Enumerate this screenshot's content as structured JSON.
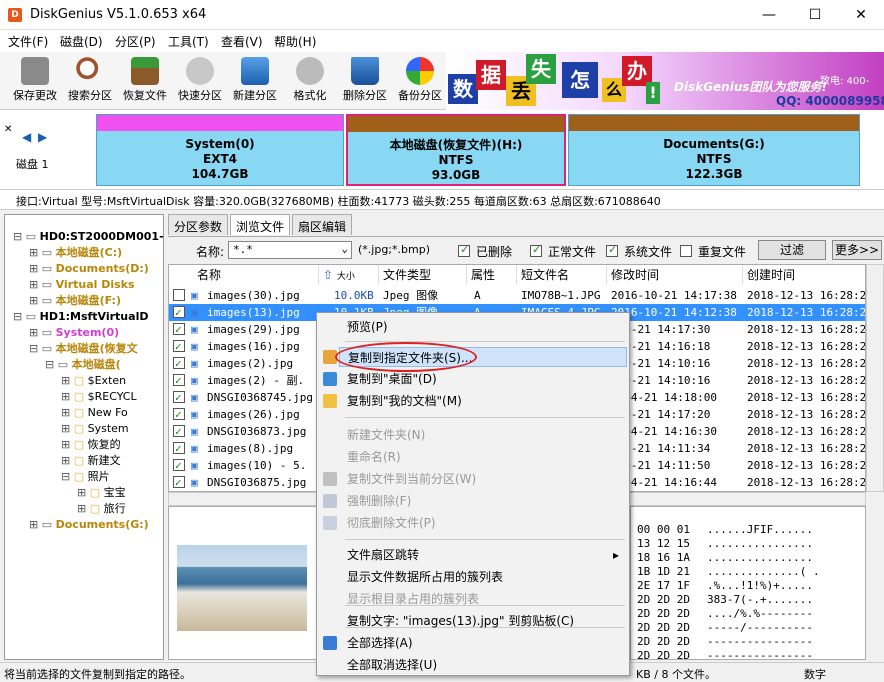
{
  "window": {
    "title": "DiskGenius V5.1.0.653 x64"
  },
  "menu": [
    "文件(F)",
    "磁盘(D)",
    "分区(P)",
    "工具(T)",
    "查看(V)",
    "帮助(H)"
  ],
  "toolbar": [
    {
      "label": "保存更改",
      "icon": "save-icon"
    },
    {
      "label": "搜索分区",
      "icon": "search-icon"
    },
    {
      "label": "恢复文件",
      "icon": "recover-icon"
    },
    {
      "label": "快速分区",
      "icon": "quick-partition-icon"
    },
    {
      "label": "新建分区",
      "icon": "new-partition-icon"
    },
    {
      "label": "格式化",
      "icon": "format-icon"
    },
    {
      "label": "删除分区",
      "icon": "delete-icon"
    },
    {
      "label": "备份分区",
      "icon": "backup-icon"
    }
  ],
  "banner": {
    "chars": [
      "数",
      "据",
      "丢",
      "失",
      "怎",
      "么",
      "办",
      "!"
    ],
    "slogan": "DiskGenius团队为您服务!",
    "phone_label": "QQ: 4000089958",
    "tel": "致电: 400-"
  },
  "disk": {
    "label": "磁盘 1",
    "partitions": [
      {
        "name": "System(0)",
        "fs": "EXT4",
        "size": "104.7GB"
      },
      {
        "name": "本地磁盘(恢复文件)(H:)",
        "fs": "NTFS",
        "size": "93.0GB"
      },
      {
        "name": "Documents(G:)",
        "fs": "NTFS",
        "size": "122.3GB"
      }
    ],
    "info": "接口:Virtual  型号:MsftVirtualDisk  容量:320.0GB(327680MB)  柱面数:41773  磁头数:255  每道扇区数:63  总扇区数:671088640"
  },
  "tree": [
    {
      "text": "HD0:ST2000DM001-",
      "bold": true,
      "color": "#000"
    },
    {
      "text": "本地磁盘(C:)",
      "bold": true,
      "color": "#b8860b"
    },
    {
      "text": "Documents(D:)",
      "bold": true,
      "color": "#b8860b"
    },
    {
      "text": "Virtual Disks",
      "bold": true,
      "color": "#b8860b"
    },
    {
      "text": "本地磁盘(F:)",
      "bold": true,
      "color": "#b8860b"
    },
    {
      "text": "HD1:MsftVirtualD",
      "bold": true,
      "color": "#000"
    },
    {
      "text": "System(0)",
      "bold": true,
      "color": "#d040d0"
    },
    {
      "text": "本地磁盘(恢复文",
      "bold": true,
      "color": "#b8860b"
    },
    {
      "text": "本地磁盘(",
      "bold": true,
      "color": "#b8860b"
    },
    {
      "text": "$Exten",
      "bold": false,
      "color": "#000"
    },
    {
      "text": "$RECYCL",
      "bold": false,
      "color": "#000"
    },
    {
      "text": "New Fo",
      "bold": false,
      "color": "#000"
    },
    {
      "text": "System",
      "bold": false,
      "color": "#000"
    },
    {
      "text": "恢复的",
      "bold": false,
      "color": "#000"
    },
    {
      "text": "新建文",
      "bold": false,
      "color": "#000"
    },
    {
      "text": "照片",
      "bold": false,
      "color": "#000"
    },
    {
      "text": "宝宝",
      "bold": false,
      "color": "#000"
    },
    {
      "text": "旅行",
      "bold": false,
      "color": "#000"
    },
    {
      "text": "Documents(G:)",
      "bold": true,
      "color": "#b8860b"
    }
  ],
  "tabs": [
    "分区参数",
    "浏览文件",
    "扇区编辑"
  ],
  "filter": {
    "name_label": "名称:",
    "name_value": "*.*",
    "hint": "(*.jpg;*.bmp)",
    "checks": [
      "已删除",
      "正常文件",
      "系统文件",
      "重复文件"
    ],
    "filter_btn": "过滤",
    "more_btn": "更多>>"
  },
  "columns": [
    "名称",
    "大小",
    "文件类型",
    "属性",
    "短文件名",
    "修改时间",
    "创建时间"
  ],
  "files": [
    {
      "name": "images(30).jpg",
      "size": "10.0KB",
      "type": "Jpeg 图像",
      "attr": "A",
      "short": "IMO78B~1.JPG",
      "mod": "2016-10-21 14:17:38",
      "created": "2018-12-13 16:28:24",
      "sel": false
    },
    {
      "name": "images(13).jpg",
      "size": "10.1KB",
      "type": "Jpeg 图像",
      "attr": "A",
      "short": "IMAGES~4.JPG",
      "mod": "2016-10-21 14:12:38",
      "created": "2018-12-13 16:28:24",
      "sel": true
    },
    {
      "name": "images(29).jpg",
      "size": "",
      "type": "",
      "attr": "",
      "short": "",
      "mod": "-10-21 14:17:30",
      "created": "2018-12-13 16:28:24",
      "sel": false
    },
    {
      "name": "images(16).jpg",
      "size": "",
      "type": "",
      "attr": "",
      "short": "",
      "mod": "-10-21 14:16:18",
      "created": "2018-12-13 16:28:24",
      "sel": false
    },
    {
      "name": "images(2).jpg",
      "size": "",
      "type": "",
      "attr": "",
      "short": "",
      "mod": "-10-21 14:10:16",
      "created": "2018-12-13 16:28:24",
      "sel": false
    },
    {
      "name": "images(2) - 副.",
      "size": "",
      "type": "",
      "attr": "",
      "short": "",
      "mod": "-10-21 14:10:16",
      "created": "2018-12-13 16:28:24",
      "sel": false
    },
    {
      "name": "DNSGI0368745.jpg",
      "size": "",
      "type": "",
      "attr": "",
      "short": "",
      "mod": "7-04-21 14:18:00",
      "created": "2018-12-13 16:28:24",
      "sel": false
    },
    {
      "name": "images(26).jpg",
      "size": "",
      "type": "",
      "attr": "",
      "short": "",
      "mod": "-10-21 14:17:20",
      "created": "2018-12-13 16:28:24",
      "sel": false
    },
    {
      "name": "DNSGI036873.jpg",
      "size": "",
      "type": "",
      "attr": "",
      "short": "",
      "mod": "7-04-21 14:16:30",
      "created": "2018-12-13 16:28:24",
      "sel": false
    },
    {
      "name": "images(8).jpg",
      "size": "",
      "type": "",
      "attr": "",
      "short": "",
      "mod": "-10-21 14:11:34",
      "created": "2018-12-13 16:28:24",
      "sel": false
    },
    {
      "name": "images(10) - 5.",
      "size": "",
      "type": "",
      "attr": "",
      "short": "",
      "mod": "-10-21 14:11:50",
      "created": "2018-12-13 16:28:24",
      "sel": false
    },
    {
      "name": "DNSGI036875.jpg",
      "size": "",
      "type": "",
      "attr": "",
      "short": "",
      "mod": "7-04-21 14:16:44",
      "created": "2018-12-13 16:28:24",
      "sel": false
    }
  ],
  "hex": [
    {
      "b": "00 00 01",
      "a": "......JFIF......"
    },
    {
      "b": "13 12 15",
      "a": "................"
    },
    {
      "b": "18 16 1A",
      "a": "................"
    },
    {
      "b": "1B 1D 21",
      "a": "..............( ."
    },
    {
      "b": "2E 17 1F",
      "a": ".%...!1!%)+....."
    },
    {
      "b": "2D 2D 2D",
      "a": "383-7(-.+......."
    },
    {
      "b": "2D 2D 2D",
      "a": "..../%.%--------"
    },
    {
      "b": "2D 2D 2D",
      "a": "-----/----------"
    },
    {
      "b": "2D 2D 2D",
      "a": "----------------"
    },
    {
      "b": "2D 2D 2D",
      "a": "----------------"
    }
  ],
  "context_menu": [
    {
      "label": "预览(P)",
      "enabled": true,
      "icon": ""
    },
    {
      "label": "复制到指定文件夹(S)...",
      "enabled": true,
      "icon": "copy-folder-icon",
      "highlight": true
    },
    {
      "label": "复制到\"桌面\"(D)",
      "enabled": true,
      "icon": "desktop-icon"
    },
    {
      "label": "复制到\"我的文档\"(M)",
      "enabled": true,
      "icon": "folder-icon"
    },
    {
      "label": "新建文件夹(N)",
      "enabled": false,
      "icon": ""
    },
    {
      "label": "重命名(R)",
      "enabled": false,
      "icon": ""
    },
    {
      "label": "复制文件到当前分区(W)",
      "enabled": false,
      "icon": "copy-icon"
    },
    {
      "label": "强制删除(F)",
      "enabled": false,
      "icon": "delete-icon"
    },
    {
      "label": "彻底删除文件(P)",
      "enabled": false,
      "icon": "erase-icon"
    },
    {
      "label": "文件扇区跳转",
      "enabled": true,
      "icon": "",
      "submenu": true
    },
    {
      "label": "显示文件数据所占用的簇列表",
      "enabled": true,
      "icon": ""
    },
    {
      "label": "显示根目录占用的簇列表",
      "enabled": false,
      "icon": ""
    },
    {
      "label": "复制文字: \"images(13).jpg\" 到剪贴板(C)",
      "enabled": true,
      "icon": ""
    },
    {
      "label": "全部选择(A)",
      "enabled": true,
      "icon": "check-icon"
    },
    {
      "label": "全部取消选择(U)",
      "enabled": true,
      "icon": ""
    }
  ],
  "status": {
    "left": "将当前选择的文件复制到指定的路径。",
    "right": "KB / 8 个文件。",
    "mode": "数字"
  },
  "colors": {
    "accent": "#3390ff",
    "partition": "#88d8f4",
    "system_bar": "#f050f0",
    "partition_cap": "#a0601a",
    "highlight_ring": "#e02020"
  }
}
